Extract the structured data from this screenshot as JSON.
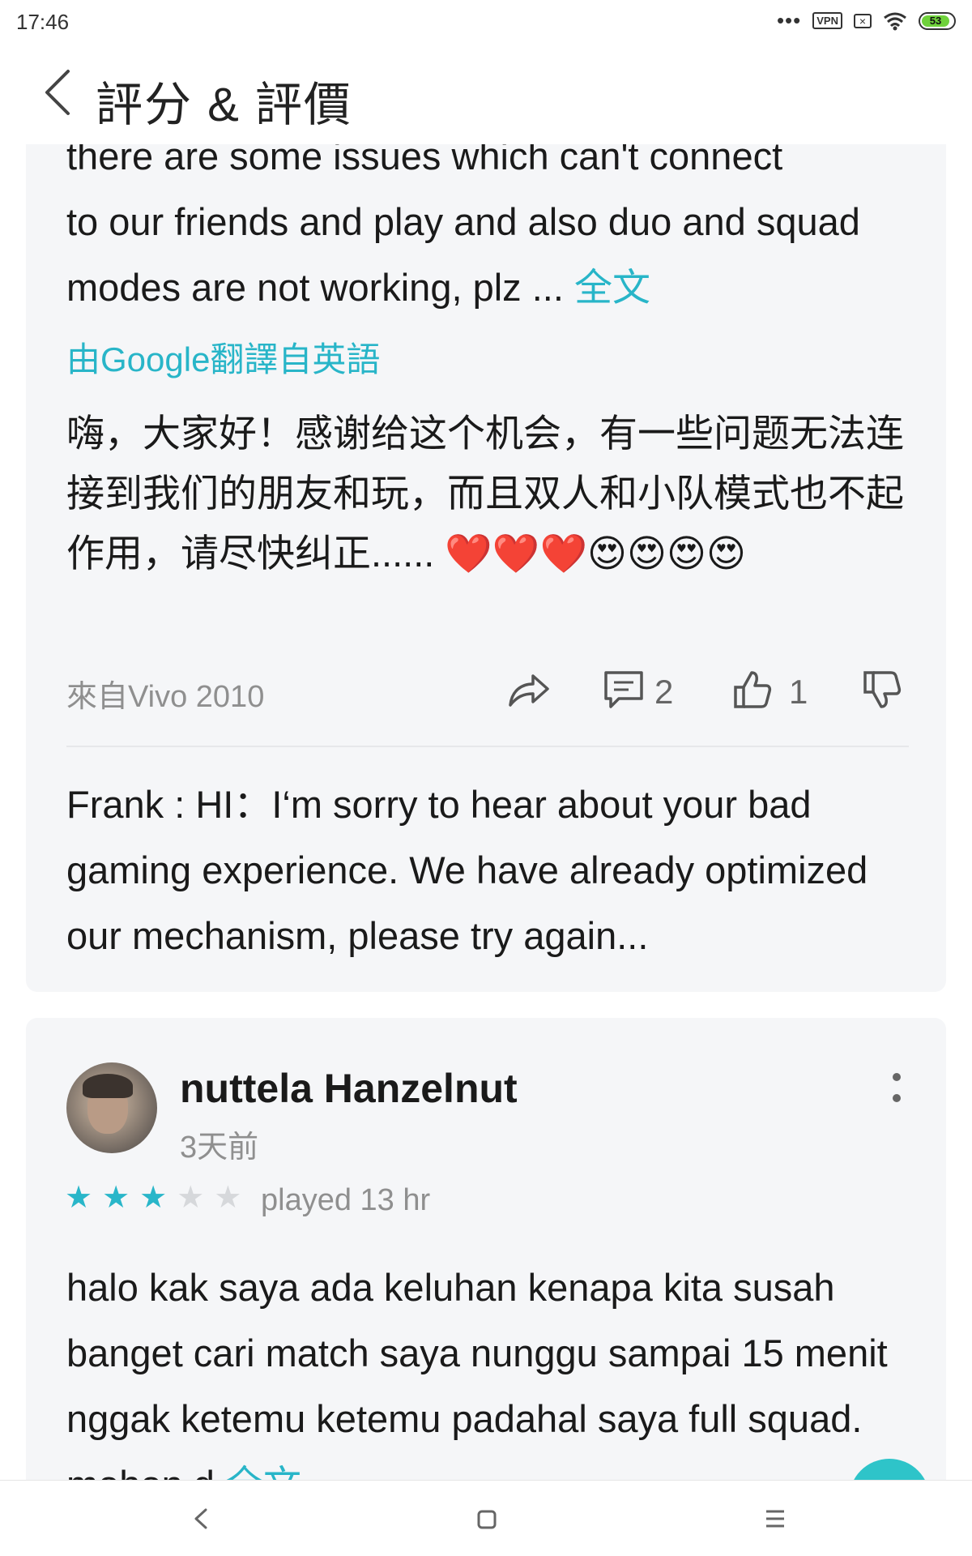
{
  "status_bar": {
    "time": "17:46",
    "dots": "•••",
    "vpn": "VPN",
    "battery": "53",
    "icons": [
      "dots-icon",
      "vpn-icon",
      "x-box-icon",
      "wifi-icon",
      "battery-icon"
    ]
  },
  "header": {
    "title": "評分 & 評價",
    "back_icon": "chevron-left-icon"
  },
  "review1": {
    "original_text_line1": "there are some issues which can't connect",
    "original_text_rest": "to our friends and play and also duo and squad modes are not working, plz ... ",
    "full_text_link": "全文",
    "translated_by": "由Google翻譯自英語",
    "translated_text": "嗨，大家好！感谢给这个机会，有一些问题无法连接到我们的朋友和玩，而且双人和小队模式也不起作用，请尽快纠正...... ❤️❤️❤️😍😍😍😍",
    "device": "來自Vivo 2010",
    "comment_count": "2",
    "like_count": "1",
    "icons": [
      "share-icon",
      "comment-icon",
      "thumbs-up-icon",
      "thumbs-down-icon"
    ],
    "developer_reply": "Frank : HI：I‘m sorry to hear about your bad gaming experience. We have already optimized our mechanism, please try again..."
  },
  "review2": {
    "user_name": "nuttela Hanzelnut",
    "time_ago": "3天前",
    "rating": 3,
    "rating_max": 5,
    "played": "played 13 hr",
    "text": "halo kak saya ada keluhan kenapa kita susah banget cari match saya nunggu sampai 15 menit nggak ketemu ketemu padahal saya full squad. mohon d",
    "full_text_link": "全文",
    "icons": [
      "more-vertical-icon"
    ]
  },
  "nav_bar": {
    "icons": [
      "nav-back-icon",
      "nav-home-icon",
      "nav-menu-icon"
    ]
  },
  "colors": {
    "accent": "#28b5c8",
    "card_bg": "#f5f6f8",
    "muted_text": "#8f8f8f",
    "star_on": "#29b6c9",
    "star_off": "#d6d8db"
  }
}
